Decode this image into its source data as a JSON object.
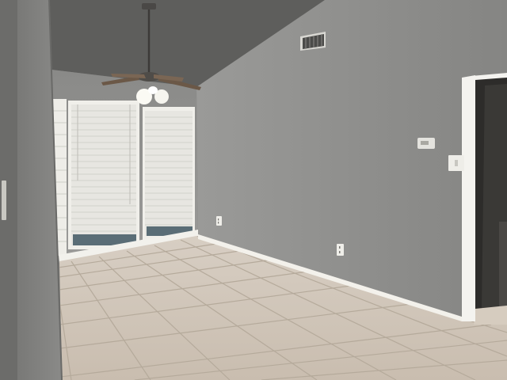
{
  "scene": {
    "subject": "empty-room-interior",
    "colors": {
      "wall_main": "#8c8c8a",
      "wall_light": "#9d9d9b",
      "wall_shadow": "#707070",
      "ceiling": "#5f5f5d",
      "ceiling_right": "#6e6e6c",
      "floor_tile": "#cfc4b7",
      "grout": "#b3a899",
      "baseboard": "#f1efe9",
      "blind": "#ecebe6",
      "trim": "#f4f3ef",
      "doorway_dark": "#2c2b29"
    },
    "icons": [
      "ceiling-fan-icon",
      "air-vent-icon",
      "thermostat-icon",
      "light-switch-icon",
      "wall-outlet-icon"
    ]
  }
}
